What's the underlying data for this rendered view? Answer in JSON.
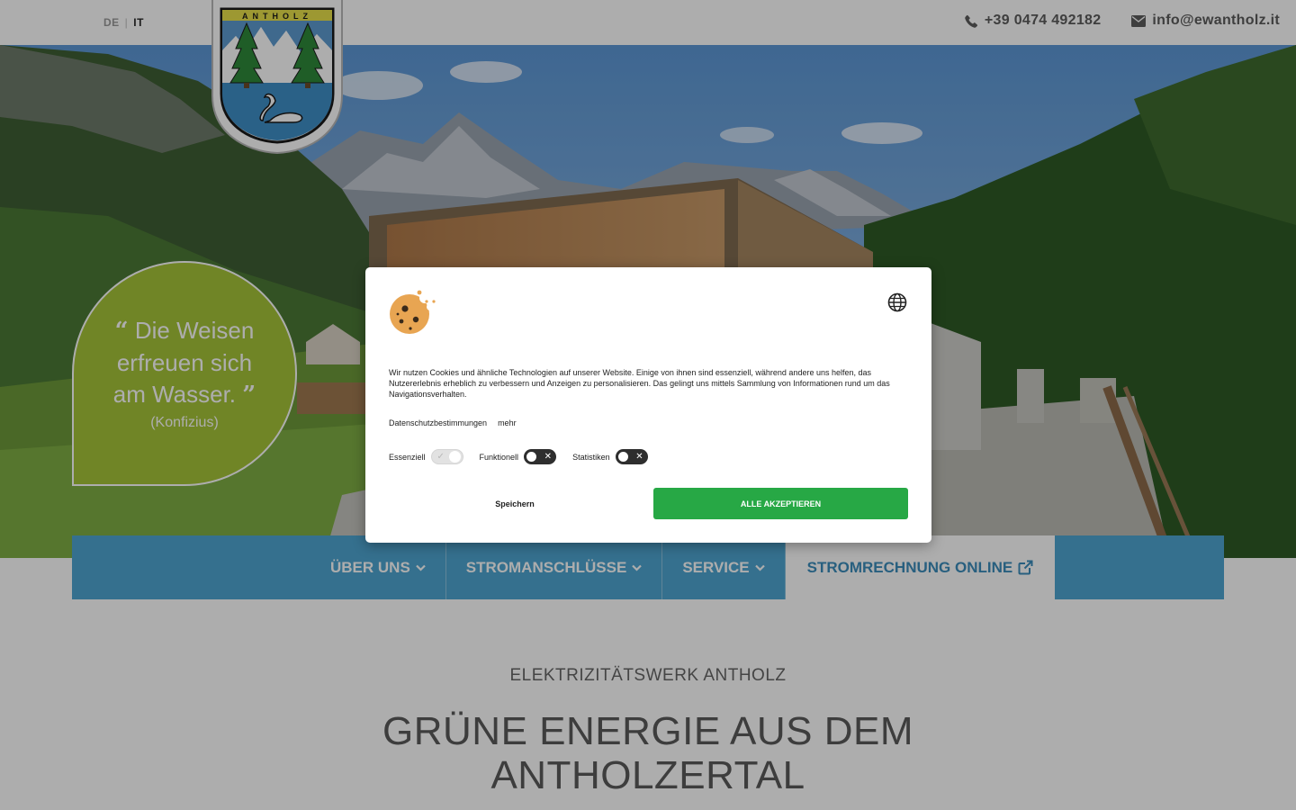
{
  "topbar": {
    "languages": [
      "DE",
      "IT"
    ],
    "active_language": "IT",
    "phone": "+39 0474 492182",
    "email": "info@ewantholz.it"
  },
  "crest": {
    "text": "ANTHOLZ"
  },
  "quote": {
    "open": "“",
    "text": "Die Weisen erfreuen sich am Wasser.",
    "close": "”",
    "author": "(Konfizius)"
  },
  "nav": {
    "items": [
      {
        "label": "ÜBER UNS",
        "icon": "chevron-down-icon"
      },
      {
        "label": "STROMANSCHLÜSSE",
        "icon": "chevron-down-icon"
      },
      {
        "label": "SERVICE",
        "icon": "chevron-down-icon"
      },
      {
        "label": "STROMRECHNUNG ONLINE",
        "icon": "external-link-icon"
      }
    ]
  },
  "content": {
    "subtitle": "ELEKTRIZITÄTSWERK ANTHOLZ",
    "heading": "GRÜNE ENERGIE AUS DEM ANTHOLZERTAL"
  },
  "cookie_dialog": {
    "description": "Wir nutzen Cookies und ähnliche Technologien auf unserer Website. Einige von ihnen sind essenziell, während andere uns helfen, das Nutzererlebnis erheblich zu verbessern und Anzeigen zu personalisieren. Das gelingt uns mittels Sammlung von Informationen rund um das Navigationsverhalten.",
    "privacy_link": "Datenschutzbestimmungen",
    "more_link": "mehr",
    "toggles": [
      {
        "label": "Essenziell",
        "enabled": true,
        "locked": true
      },
      {
        "label": "Funktionell",
        "enabled": false
      },
      {
        "label": "Statistiken",
        "enabled": false
      }
    ],
    "save_label": "Speichern",
    "accept_label": "ALLE AKZEPTIEREN"
  },
  "colors": {
    "nav_blue": "#4fa6d1",
    "quote_green": "#a6c539",
    "accept_green": "#27a845",
    "overlay": "rgba(0,0,0,0.32)"
  }
}
